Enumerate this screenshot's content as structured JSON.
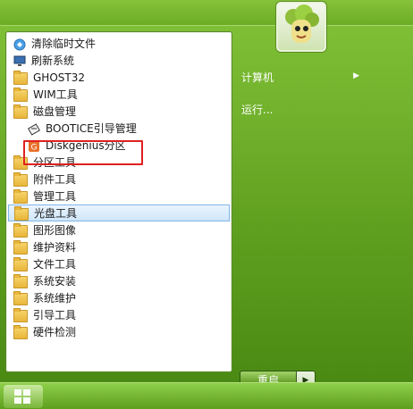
{
  "left_menu": {
    "items": [
      {
        "label": "清除临时文件",
        "icon": "broom-icon"
      },
      {
        "label": "刷新系统",
        "icon": "monitor-icon"
      },
      {
        "label": "GHOST32",
        "icon": "folder-icon"
      },
      {
        "label": "WIM工具",
        "icon": "folder-icon"
      },
      {
        "label": "磁盘管理",
        "icon": "folder-icon"
      },
      {
        "label": "BOOTICE引导管理",
        "icon": "bootice-icon"
      },
      {
        "label": "Diskgenius分区",
        "icon": "diskgenius-icon"
      },
      {
        "label": "分区工具",
        "icon": "folder-icon"
      },
      {
        "label": "附件工具",
        "icon": "folder-icon"
      },
      {
        "label": "管理工具",
        "icon": "folder-icon"
      },
      {
        "label": "光盘工具",
        "icon": "folder-icon"
      },
      {
        "label": "图形图像",
        "icon": "folder-icon"
      },
      {
        "label": "维护资料",
        "icon": "folder-icon"
      },
      {
        "label": "文件工具",
        "icon": "folder-icon"
      },
      {
        "label": "系统安装",
        "icon": "folder-icon"
      },
      {
        "label": "系统维护",
        "icon": "folder-icon"
      },
      {
        "label": "引导工具",
        "icon": "folder-icon"
      },
      {
        "label": "硬件检测",
        "icon": "folder-icon"
      }
    ]
  },
  "right_menu": {
    "computer_label": "计算机",
    "run_label": "运行..."
  },
  "restart": {
    "label": "重启"
  },
  "colors": {
    "highlight_border": "#e02020",
    "selected_bg": "#cfe6fb",
    "desktop_green": "#5a9a1c"
  }
}
